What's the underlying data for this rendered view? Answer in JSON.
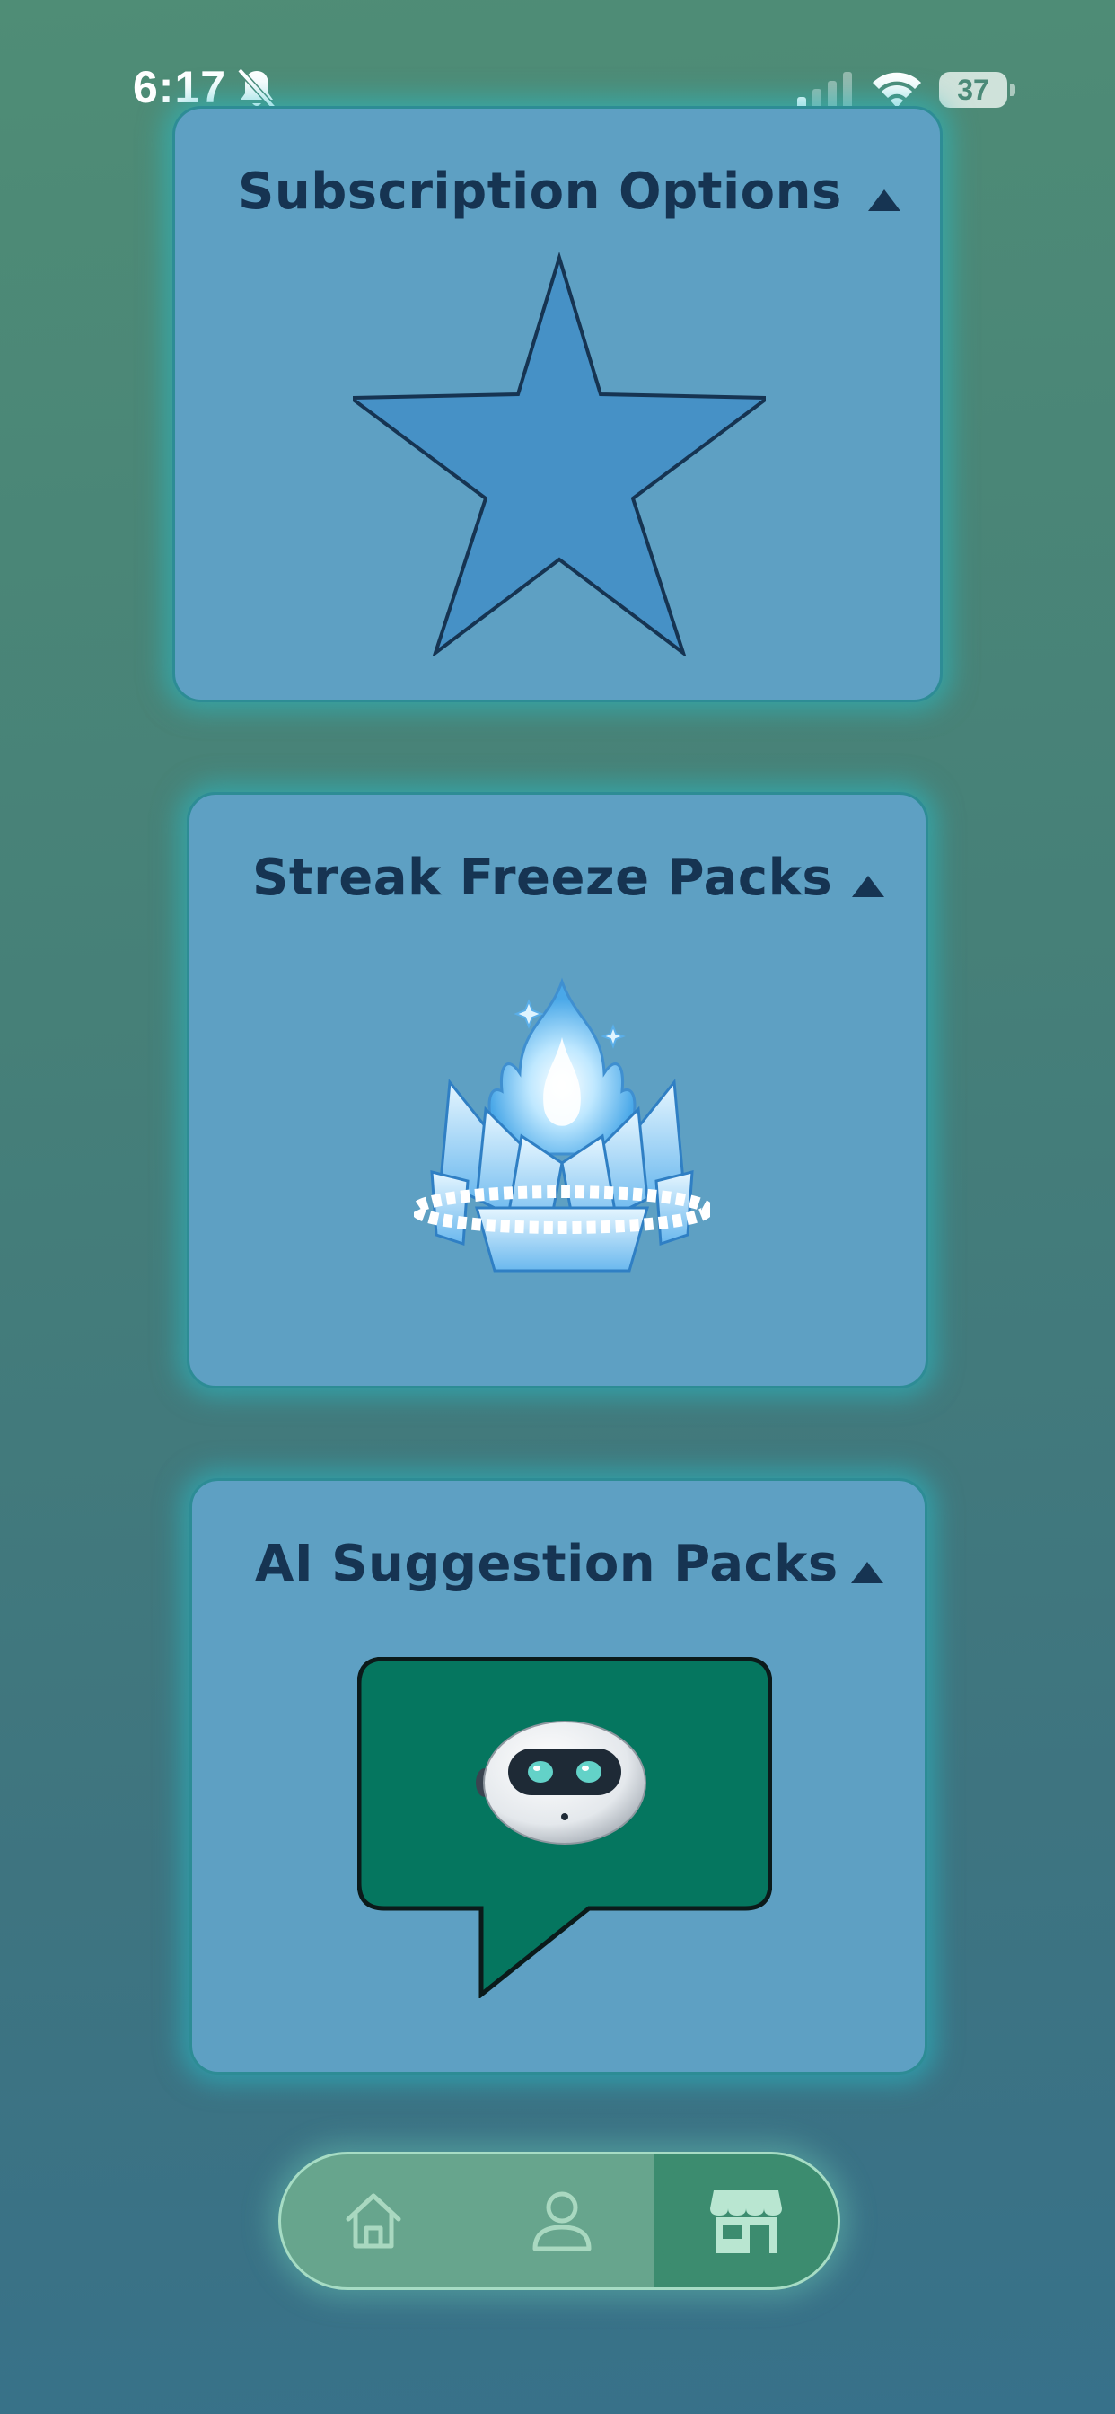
{
  "status_bar": {
    "time": "6:17",
    "battery": "37",
    "icons": [
      "bell-slash-icon",
      "cellular-signal-icon",
      "wifi-icon",
      "battery-icon"
    ]
  },
  "cards": [
    {
      "title": "Subscription Options",
      "icon": "caret-up-icon",
      "image": "star-icon"
    },
    {
      "title": "Streak Freeze Packs",
      "icon": "caret-up-icon",
      "image": "ice-flame-icon"
    },
    {
      "title": "AI Suggestion Packs",
      "icon": "caret-up-icon",
      "image": "robot-chat-bubble-icon"
    }
  ],
  "bottom_nav": {
    "items": [
      {
        "icon": "home-icon",
        "active": false
      },
      {
        "icon": "profile-icon",
        "active": false
      },
      {
        "icon": "store-icon",
        "active": true
      }
    ]
  },
  "colors": {
    "card_background": "#5ea0c3",
    "card_border": "#2d8c95",
    "title_text": "#163452",
    "nav_background": "#67a58d",
    "nav_active": "#3c8c6f"
  }
}
